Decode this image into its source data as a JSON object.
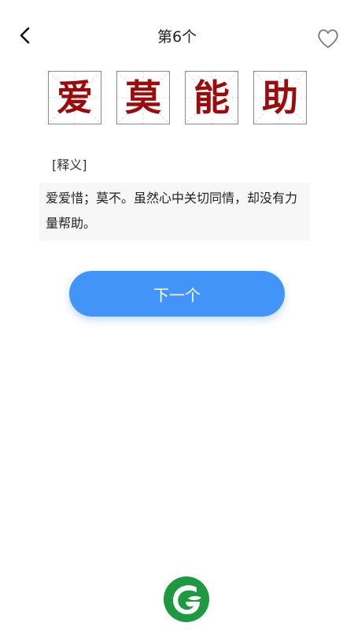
{
  "header": {
    "title": "第6个",
    "back_icon": "chevron-left-icon",
    "favorite_icon": "heart-outline-icon"
  },
  "idiom": {
    "chars": [
      "爱",
      "莫",
      "能",
      "助"
    ],
    "char_color": "#9c0b0b"
  },
  "definition": {
    "label": "[释义]",
    "text": "爱爱惜；莫不。虽然心中关切同情，却没有力量帮助。"
  },
  "actions": {
    "next_label": "下一个",
    "accent_color": "#4394f8"
  },
  "footer": {
    "logo_icon": "leaf-g-logo-icon",
    "logo_color": "#1d9a3f"
  }
}
